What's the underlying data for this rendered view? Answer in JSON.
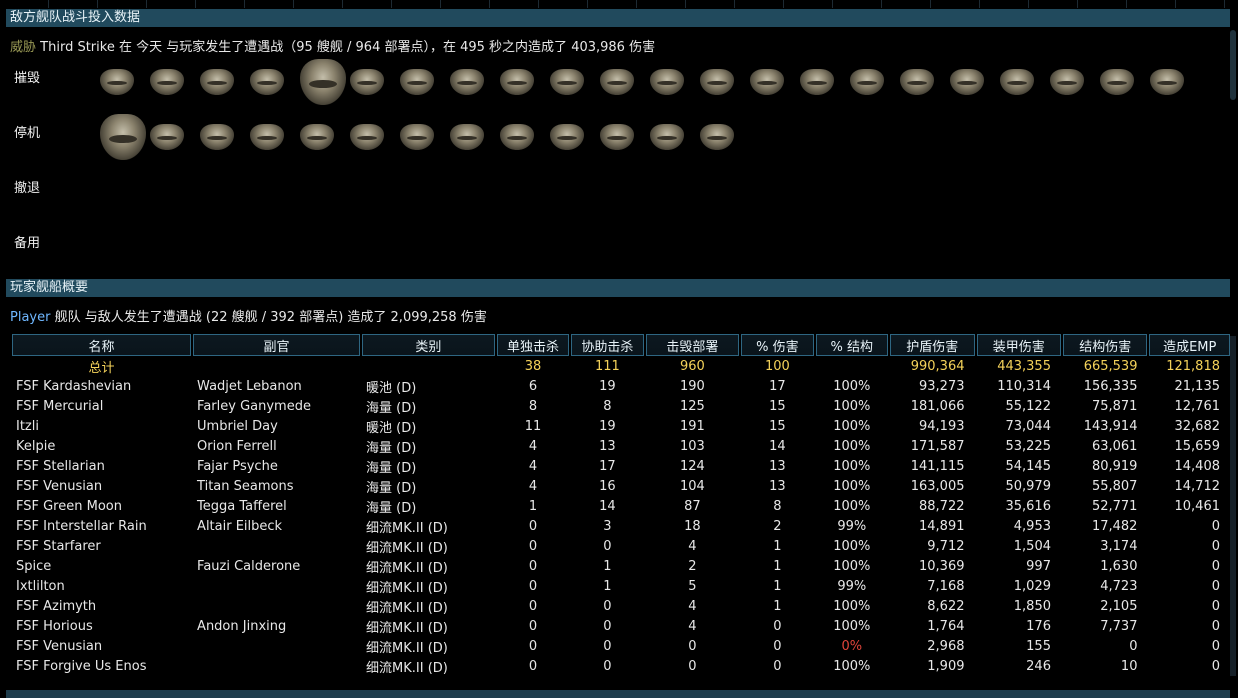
{
  "enemy_section": {
    "title": "敌方舰队战斗投入数据",
    "summary": {
      "threat_label": "威胁",
      "text": "Third Strike 在 今天 与玩家发生了遭遇战（95 艘舰 / 964 部署点），在 495 秒之内造成了 403,986 伤害"
    },
    "rows": {
      "destroyed": "摧毁",
      "disabled": "停机",
      "retreated": "撤退",
      "reserve": "备用"
    }
  },
  "player_section": {
    "title": "玩家舰船概要",
    "summary": {
      "player_label": "Player",
      "text": " 舰队 与敌人发生了遭遇战 (22 艘舰 / 392 部署点) 造成了 2,099,258 伤害"
    }
  },
  "table": {
    "headers": [
      "名称",
      "副官",
      "类别",
      "单独击杀",
      "协助击杀",
      "击毁部署",
      "% 伤害",
      "% 结构",
      "护盾伤害",
      "装甲伤害",
      "结构伤害",
      "造成EMP"
    ],
    "total": {
      "label": "总计",
      "solo": "38",
      "assist": "111",
      "destroyed_dp": "960",
      "pct_damage": "100",
      "shield": "990,364",
      "armor": "443,355",
      "hull": "665,539",
      "emp": "121,818"
    },
    "rows": [
      [
        "FSF Kardashevian",
        "Wadjet Lebanon",
        "暖池 (D)",
        "6",
        "19",
        "190",
        "17",
        "100%",
        "93,273",
        "110,314",
        "156,335",
        "21,135"
      ],
      [
        "FSF Mercurial",
        "Farley Ganymede",
        "海量 (D)",
        "8",
        "8",
        "125",
        "15",
        "100%",
        "181,066",
        "55,122",
        "75,871",
        "12,761"
      ],
      [
        "Itzli",
        "Umbriel Day",
        "暖池 (D)",
        "11",
        "19",
        "191",
        "15",
        "100%",
        "94,193",
        "73,044",
        "143,914",
        "32,682"
      ],
      [
        "Kelpie",
        "Orion Ferrell",
        "海量 (D)",
        "4",
        "13",
        "103",
        "14",
        "100%",
        "171,587",
        "53,225",
        "63,061",
        "15,659"
      ],
      [
        "FSF Stellarian",
        "Fajar Psyche",
        "海量 (D)",
        "4",
        "17",
        "124",
        "13",
        "100%",
        "141,115",
        "54,145",
        "80,919",
        "14,408"
      ],
      [
        "FSF Venusian",
        "Titan Seamons",
        "海量 (D)",
        "4",
        "16",
        "104",
        "13",
        "100%",
        "163,005",
        "50,979",
        "55,807",
        "14,712"
      ],
      [
        "FSF Green Moon",
        "Tegga Tafferel",
        "海量 (D)",
        "1",
        "14",
        "87",
        "8",
        "100%",
        "88,722",
        "35,616",
        "52,771",
        "10,461"
      ],
      [
        "FSF Interstellar Rain",
        "Altair Eilbeck",
        "细流MK.II (D)",
        "0",
        "3",
        "18",
        "2",
        "99%",
        "14,891",
        "4,953",
        "17,482",
        "0"
      ],
      [
        "FSF Starfarer",
        "",
        "细流MK.II (D)",
        "0",
        "0",
        "4",
        "1",
        "100%",
        "9,712",
        "1,504",
        "3,174",
        "0"
      ],
      [
        "Spice",
        "Fauzi Calderone",
        "细流MK.II (D)",
        "0",
        "1",
        "2",
        "1",
        "100%",
        "10,369",
        "997",
        "1,630",
        "0"
      ],
      [
        "Ixtlilton",
        "",
        "细流MK.II (D)",
        "0",
        "1",
        "5",
        "1",
        "99%",
        "7,168",
        "1,029",
        "4,723",
        "0"
      ],
      [
        "FSF Azimyth",
        "",
        "细流MK.II (D)",
        "0",
        "0",
        "4",
        "1",
        "100%",
        "8,622",
        "1,850",
        "2,105",
        "0"
      ],
      [
        "FSF Horious",
        "Andon Jinxing",
        "细流MK.II (D)",
        "0",
        "0",
        "4",
        "0",
        "100%",
        "1,764",
        "176",
        "7,737",
        "0"
      ],
      [
        "FSF Venusian",
        "",
        "细流MK.II (D)",
        "0",
        "0",
        "0",
        "0",
        "0%",
        "2,968",
        "155",
        "0",
        "0"
      ],
      [
        "FSF Forgive Us Enos",
        "",
        "细流MK.II (D)",
        "0",
        "0",
        "0",
        "0",
        "100%",
        "1,909",
        "246",
        "10",
        "0"
      ]
    ]
  },
  "ship_icons": {
    "destroyed_count": 22,
    "disabled_count": 13
  },
  "colors": {
    "header_bar": "#214a5d",
    "total_row": "#f4d25a",
    "player_accent": "#6fb7ff",
    "threat_accent": "#9a9a55",
    "warning": "#e0443a"
  }
}
